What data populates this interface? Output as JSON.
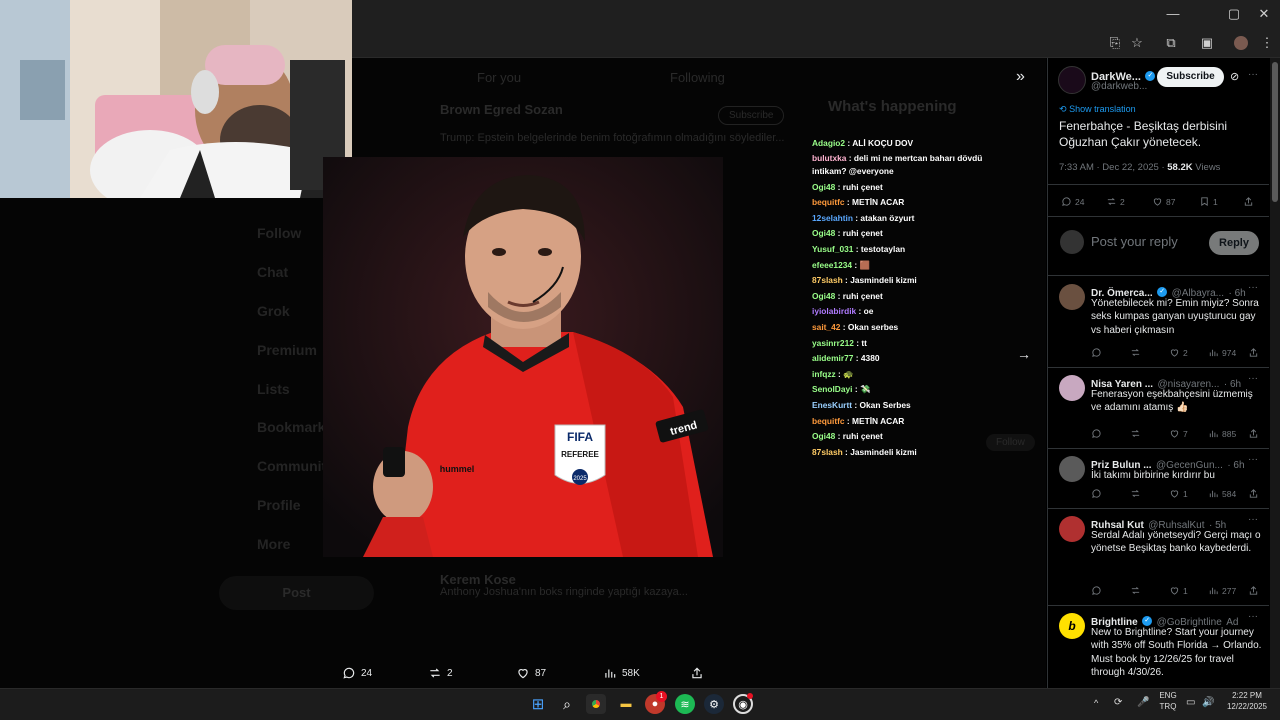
{
  "browser": {
    "url_fragment": "l",
    "window_controls": {
      "minimize": "—",
      "maximize": "▢",
      "close": "✕"
    }
  },
  "background_tweet": {
    "tab_for_you": "For you",
    "tab_following": "Following",
    "user1": "Brown Egred Sozan",
    "user1_text": "Trump: Epstein belgelerinde benim fotoğrafımın olmadığını söylediler...",
    "user2": "Kerem Kose",
    "user2_text": "Anthony Joshua'nın boks ringinde yaptığı kazaya...",
    "follow": "Follow",
    "subscribe": "Subscribe",
    "whats_happening": "What's happening",
    "post": "Post",
    "nav": [
      "Follow",
      "Chat",
      "Grok",
      "Premium",
      "Lists",
      "Bookmarks",
      "Communities",
      "Profile",
      "More"
    ]
  },
  "chat": [
    {
      "user": "Adagio2",
      "color": "#9aff8a",
      "text": "ALİ KOÇU DOV"
    },
    {
      "user": "bulutxka",
      "color": "#ffb3d0",
      "text": "deli mi ne mertcan baharı dövdü intikam? @everyone"
    },
    {
      "user": "Ogi48",
      "color": "#9aff8a",
      "text": "ruhi çenet"
    },
    {
      "user": "bequitfc",
      "color": "#ff9a3c",
      "text": "METİN ACAR"
    },
    {
      "user": "12selahtin",
      "color": "#5aa8ff",
      "text": "atakan özyurt"
    },
    {
      "user": "Ogi48",
      "color": "#9aff8a",
      "text": "ruhi çenet"
    },
    {
      "user": "Yusuf_031",
      "color": "#9aff8a",
      "text": "testotaylan"
    },
    {
      "user": "efeee1234",
      "color": "#9aff8a",
      "text": "🟫"
    },
    {
      "user": "87slash",
      "color": "#ffcc66",
      "text": "Jasmindeli kizmi"
    },
    {
      "user": "Ogi48",
      "color": "#9aff8a",
      "text": "ruhi çenet"
    },
    {
      "user": "iyiolabirdik",
      "color": "#b07bff",
      "text": "oe"
    },
    {
      "user": "sait_42",
      "color": "#ff9a3c",
      "text": "Okan serbes"
    },
    {
      "user": "yasinrr212",
      "color": "#9aff8a",
      "text": "tt"
    },
    {
      "user": "alidemir77",
      "color": "#9aff8a",
      "text": "4380"
    },
    {
      "user": "infqzz",
      "color": "#9aff8a",
      "text": "🐢"
    },
    {
      "user": "SenolDayi",
      "color": "#9aff8a",
      "text": "💸"
    },
    {
      "user": "EnesKurtt",
      "color": "#9ad0ff",
      "text": "Okan Serbes"
    },
    {
      "user": "bequitfc",
      "color": "#ff9a3c",
      "text": "METİN ACAR"
    },
    {
      "user": "Ogi48",
      "color": "#9aff8a",
      "text": "ruhi çenet"
    },
    {
      "user": "87slash",
      "color": "#ffcc66",
      "text": "Jasmindeli kizmi"
    }
  ],
  "photo": {
    "badge_top": "FIFA",
    "badge_mid": "REFEREE",
    "badge_year": "2025",
    "sleeve": "trend",
    "brand": "hummel"
  },
  "media_stats": {
    "replies": "24",
    "reposts": "2",
    "likes": "87",
    "views": "58K"
  },
  "panel": {
    "author_name": "DarkWe...",
    "author_handle": "@darkweb...",
    "subscribe": "Subscribe",
    "show_translation": "Show translation",
    "tweet_text": "Fenerbahçe - Beşiktaş derbisini Oğuzhan Çakır yönetecek.",
    "meta_time": "7:33 AM · Dec 22, 2025 · ",
    "meta_views": "58.2K",
    "meta_views_label": " Views",
    "actions": {
      "replies": "24",
      "reposts": "2",
      "likes": "87",
      "bookmarks": "1"
    },
    "reply_placeholder": "Post your reply",
    "reply_button": "Reply",
    "replies": [
      {
        "name": "Dr. Ömerca...",
        "handle": "@Albayra...",
        "time": "· 6h",
        "text": "Yönetebilecek mi? Emin miyiz? Sonra seks kumpas ganyan uyuşturucu gay vs haberi çıkmasın",
        "likes": "2",
        "views": "974",
        "avatar": "#6a5040",
        "verified": true
      },
      {
        "name": "Nisa Yaren ...",
        "handle": "@nisayaren...",
        "time": "· 6h",
        "text": "Fenerasyon eşekbahçesini üzmemiş ve adamını atamış 👍🏻",
        "likes": "7",
        "views": "885",
        "avatar": "#c8a8c0",
        "verified": false
      },
      {
        "name": "Priz Bulun ...",
        "handle": "@GecenGun...",
        "time": "· 6h",
        "text": "İki takımı birbirine kırdırır bu",
        "likes": "1",
        "views": "584",
        "avatar": "#5a5a5a",
        "verified": false
      },
      {
        "name": "Ruhsal Kut",
        "handle": "@RuhsalKut",
        "time": "· 5h",
        "text": "Serdal Adalı yönetseydi? Gerçi maçı o yönetse Beşiktaş banko kaybederdi.",
        "likes": "1",
        "views": "277",
        "avatar": "#b03030",
        "verified": false
      },
      {
        "name": "Brightline",
        "handle": "@GoBrightline",
        "time": "Ad",
        "text": "New to Brightline? Start your journey with 35% off  South Florida → Orlando. Must book by 12/26/25 for travel through 4/30/26.",
        "likes": "",
        "views": "",
        "avatar": "#ffe000",
        "verified": true
      }
    ]
  },
  "taskbar": {
    "lang_top": "ENG",
    "lang_bottom": "TRQ",
    "time": "2:22 PM",
    "date": "12/22/2025",
    "badge_count": "1"
  }
}
